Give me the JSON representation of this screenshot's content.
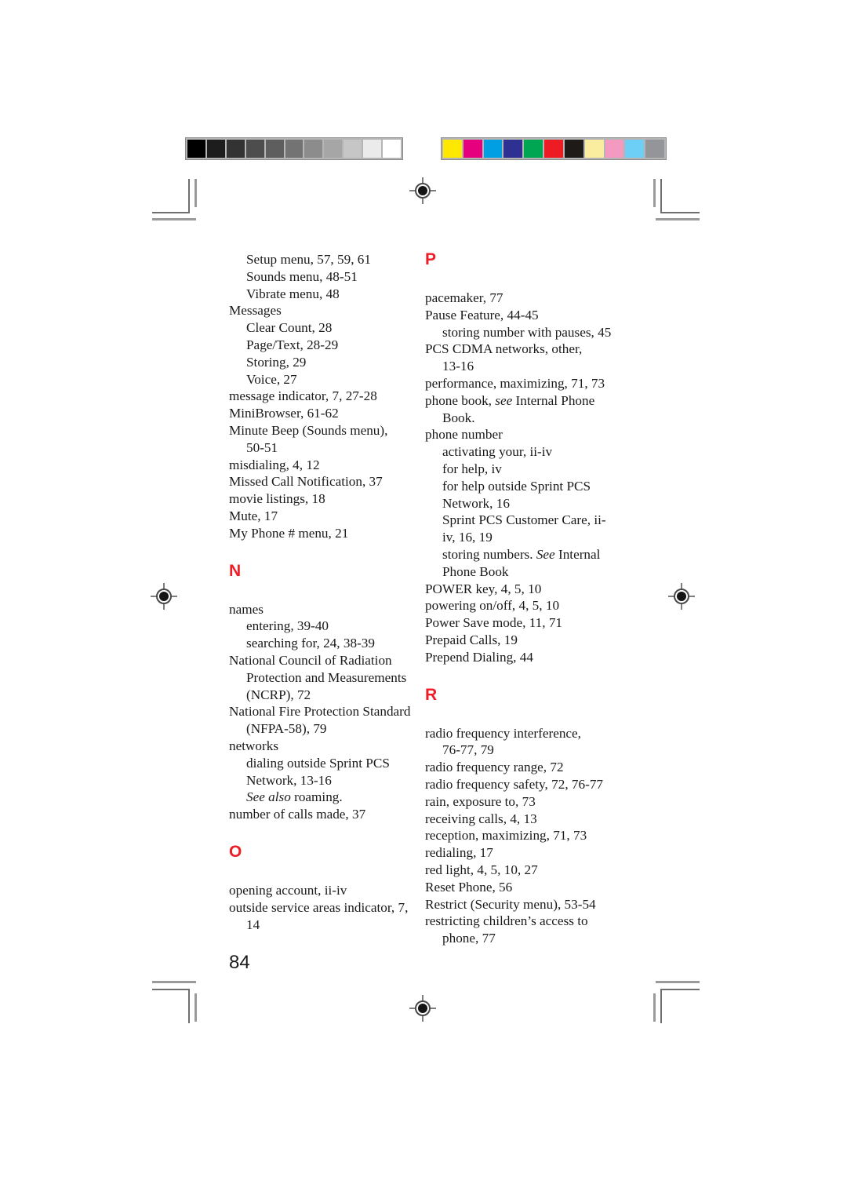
{
  "page": {
    "number": "84",
    "kind": "index-page"
  },
  "calibration": {
    "grayscale_label": "grayscale-calibration-strip",
    "grayscale_patches": [
      "#000000",
      "#1d1d1d",
      "#333333",
      "#4d4d4d",
      "#5e5e5e",
      "#737373",
      "#8c8c8c",
      "#a6a6a6",
      "#c6c6c6",
      "#ebebeb",
      "#ffffff"
    ],
    "color_label": "color-calibration-strip",
    "color_patches": [
      "#ffe800",
      "#e6007e",
      "#009fe3",
      "#2e3192",
      "#00a651",
      "#ed1c24",
      "#1e1a17",
      "#faeda0",
      "#f49ac1",
      "#6dcff6",
      "#939598"
    ]
  },
  "index": {
    "columns": [
      {
        "name": "left-column",
        "blocks": [
          {
            "letter": null,
            "entries": [
              {
                "level": 1,
                "text": "Setup menu, 57, 59, 61"
              },
              {
                "level": 1,
                "text": "Sounds menu, 48-51"
              },
              {
                "level": 1,
                "text": "Vibrate menu, 48"
              },
              {
                "level": 0,
                "text": "Messages"
              },
              {
                "level": 1,
                "text": "Clear Count, 28"
              },
              {
                "level": 1,
                "text": "Page/Text, 28-29"
              },
              {
                "level": 1,
                "text": "Storing, 29"
              },
              {
                "level": 1,
                "text": "Voice, 27"
              },
              {
                "level": 0,
                "text": "message indicator, 7, 27-28"
              },
              {
                "level": 0,
                "text": "MiniBrowser, 61-62"
              },
              {
                "level": 0,
                "text": "Minute Beep (Sounds menu),"
              },
              {
                "level": 1,
                "text": "50-51"
              },
              {
                "level": 0,
                "text": "misdialing, 4, 12"
              },
              {
                "level": 0,
                "text": "Missed Call Notification, 37"
              },
              {
                "level": 0,
                "text": "movie listings, 18"
              },
              {
                "level": 0,
                "text": "Mute, 17"
              },
              {
                "level": 0,
                "text": "My Phone # menu, 21"
              }
            ]
          },
          {
            "letter": "N",
            "entries": [
              {
                "level": 0,
                "text": "names"
              },
              {
                "level": 1,
                "text": "entering, 39-40"
              },
              {
                "level": 1,
                "text": "searching for, 24, 38-39"
              },
              {
                "level": 0,
                "text": "National Council of Radiation"
              },
              {
                "level": 1,
                "text": "Protection and Measurements"
              },
              {
                "level": 1,
                "text": "(NCRP), 72"
              },
              {
                "level": 0,
                "text": "National Fire Protection Standard"
              },
              {
                "level": 1,
                "text": "(NFPA-58), 79"
              },
              {
                "level": 0,
                "text": "networks"
              },
              {
                "level": 1,
                "text": "dialing outside Sprint PCS"
              },
              {
                "level": 1,
                "text": "Network, 13-16"
              },
              {
                "level": 1,
                "html": "<i>See also</i> roaming."
              },
              {
                "level": 0,
                "text": "number of calls made, 37"
              }
            ]
          },
          {
            "letter": "O",
            "entries": [
              {
                "level": 0,
                "text": "opening account, ii-iv"
              },
              {
                "level": 0,
                "text": "outside service areas indicator, 7,"
              },
              {
                "level": 1,
                "text": "14"
              }
            ]
          }
        ]
      },
      {
        "name": "right-column",
        "blocks": [
          {
            "letter": "P",
            "entries": [
              {
                "level": 0,
                "text": "pacemaker, 77"
              },
              {
                "level": 0,
                "text": "Pause Feature, 44-45"
              },
              {
                "level": 1,
                "text": "storing number with pauses, 45"
              },
              {
                "level": 0,
                "text": "PCS CDMA networks, other,"
              },
              {
                "level": 1,
                "text": "13-16"
              },
              {
                "level": 0,
                "text": "performance, maximizing, 71, 73"
              },
              {
                "level": 0,
                "html": "phone book, <i>see</i> Internal Phone"
              },
              {
                "level": 1,
                "text": "Book."
              },
              {
                "level": 0,
                "text": "phone number"
              },
              {
                "level": 1,
                "text": "activating your, ii-iv"
              },
              {
                "level": 1,
                "text": "for help, iv"
              },
              {
                "level": 1,
                "text": "for help outside Sprint PCS"
              },
              {
                "level": 1,
                "text": "Network, 16"
              },
              {
                "level": 1,
                "text": "Sprint PCS Customer Care, ii-"
              },
              {
                "level": 1,
                "text": "iv, 16, 19"
              },
              {
                "level": 1,
                "html": "storing numbers. <i>See</i> Internal"
              },
              {
                "level": 1,
                "text": "Phone Book"
              },
              {
                "level": 0,
                "text": "POWER key, 4, 5, 10"
              },
              {
                "level": 0,
                "text": "powering on/off, 4, 5, 10"
              },
              {
                "level": 0,
                "text": "Power Save mode, 11, 71"
              },
              {
                "level": 0,
                "text": "Prepaid Calls, 19"
              },
              {
                "level": 0,
                "text": "Prepend Dialing, 44"
              }
            ]
          },
          {
            "letter": "R",
            "entries": [
              {
                "level": 0,
                "text": "radio frequency interference,"
              },
              {
                "level": 1,
                "text": "76-77, 79"
              },
              {
                "level": 0,
                "text": "radio frequency range, 72"
              },
              {
                "level": 0,
                "text": "radio frequency safety, 72, 76-77"
              },
              {
                "level": 0,
                "text": "rain, exposure to, 73"
              },
              {
                "level": 0,
                "text": "receiving calls, 4, 13"
              },
              {
                "level": 0,
                "text": "reception, maximizing, 71, 73"
              },
              {
                "level": 0,
                "text": "redialing, 17"
              },
              {
                "level": 0,
                "text": "red light, 4, 5, 10, 27"
              },
              {
                "level": 0,
                "text": "Reset Phone, 56"
              },
              {
                "level": 0,
                "text": "Restrict (Security menu), 53-54"
              },
              {
                "level": 0,
                "text": "restricting children’s access to"
              },
              {
                "level": 1,
                "text": "phone, 77"
              }
            ]
          }
        ]
      }
    ]
  },
  "marks": {
    "accent_red": "#ee1c25",
    "registration_label": "registration-target",
    "crop_label": "crop-mark"
  }
}
